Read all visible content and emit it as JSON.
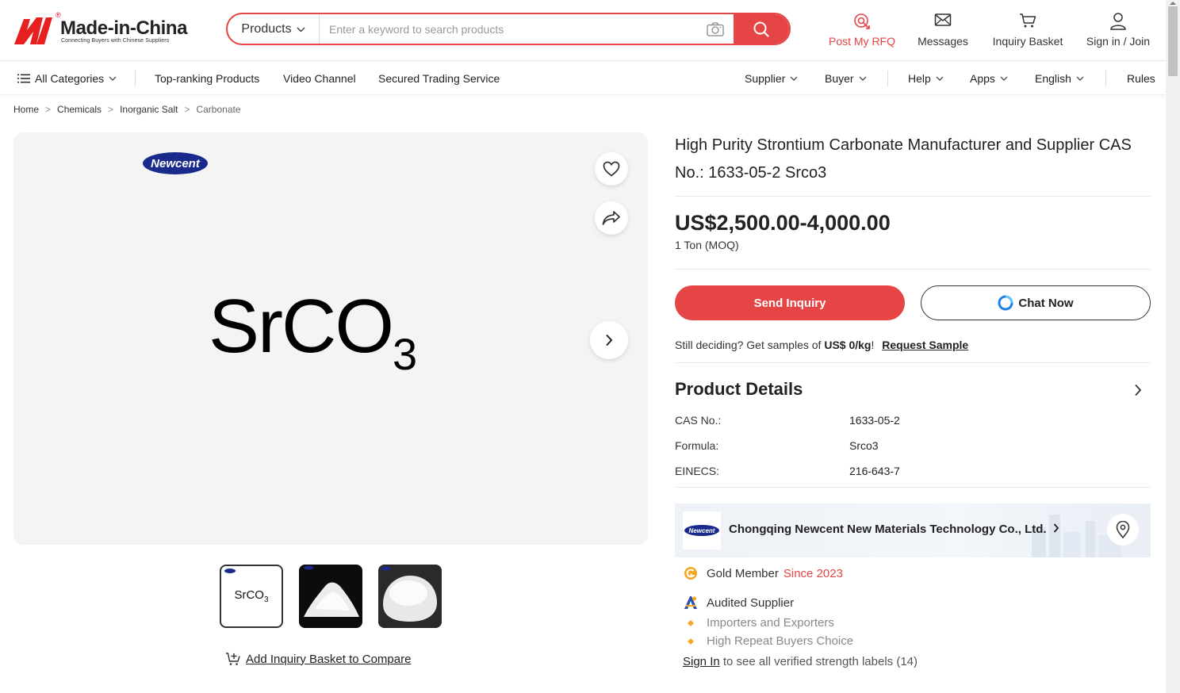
{
  "header": {
    "brand": "Made-in-China",
    "tagline": "Connecting Buyers with Chinese Suppliers",
    "search_category": "Products",
    "search_placeholder": "Enter a keyword to search products",
    "post_rfq": "Post My RFQ",
    "messages": "Messages",
    "inquiry_basket": "Inquiry Basket",
    "sign_in": "Sign in / Join"
  },
  "nav": {
    "all_categories": "All Categories",
    "top_ranking": "Top-ranking Products",
    "video_channel": "Video Channel",
    "secured_trading": "Secured Trading Service",
    "supplier": "Supplier",
    "buyer": "Buyer",
    "help": "Help",
    "apps": "Apps",
    "language": "English",
    "rules": "Rules"
  },
  "breadcrumb": [
    "Home",
    "Chemicals",
    "Inorganic Salt",
    "Carbonate"
  ],
  "gallery": {
    "watermark_logo": "Newcent",
    "main_formula": "SrCO",
    "main_formula_sub": "3",
    "thumb_formula": "SrCO",
    "thumb_formula_sub": "3",
    "compare_label": "Add Inquiry Basket to Compare"
  },
  "product": {
    "title": "High Purity Strontium Carbonate Manufacturer and Supplier CAS No.: 1633-05-2 Srco3",
    "price": "US$2,500.00-4,000.00",
    "moq": "1 Ton (MOQ)",
    "send_inquiry": "Send Inquiry",
    "chat_now": "Chat Now",
    "sample_text": "Still deciding? Get samples of",
    "sample_price": "US$ 0/kg",
    "sample_excl": "!",
    "request_sample": "Request Sample",
    "details_title": "Product Details",
    "specs": [
      {
        "key": "CAS No.:",
        "value": "1633-05-2"
      },
      {
        "key": "Formula:",
        "value": "Srco3"
      },
      {
        "key": "EINECS:",
        "value": "216-643-7"
      }
    ]
  },
  "supplier": {
    "logo_text": "Newcent",
    "name": "Chongqing Newcent New Materials Technology Co., Ltd.",
    "gold_member": "Gold Member",
    "since": "Since 2023",
    "audited": "Audited Supplier",
    "label1": "Importers and Exporters",
    "label2": "High Repeat Buyers Choice",
    "sign_in": "Sign In",
    "sign_in_rest": "to see all verified strength labels (14)"
  },
  "colors": {
    "brand_red": "#e64545",
    "text_dark": "#222222",
    "card_bg": "#f4f4f4",
    "gold": "#f5a623"
  },
  "icons": [
    "search-icon",
    "camera-icon",
    "rfq-icon",
    "mail-icon",
    "cart-icon",
    "user-icon",
    "list-icon",
    "heart-icon",
    "share-icon",
    "chevron-right-icon",
    "location-pin-icon"
  ]
}
